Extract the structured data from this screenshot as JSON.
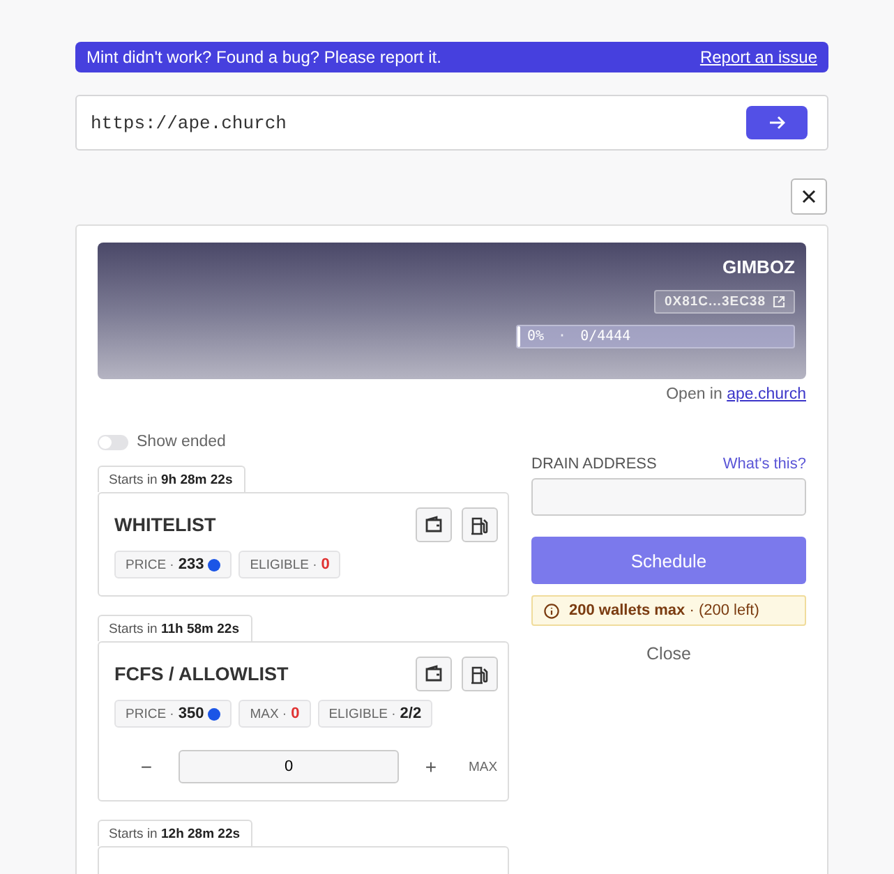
{
  "banner": {
    "message": "Mint didn't work? Found a bug? Please report it.",
    "link": "Report an issue"
  },
  "url_bar": {
    "value": "https://ape.church"
  },
  "collection": {
    "name": "GIMBOZ",
    "address": "0X81C...3EC38",
    "progress_percent": "0%",
    "progress_separator": "·",
    "progress_count": "0/4444",
    "level": 0,
    "open_in_prefix": "Open in",
    "open_in_link": "ape.church"
  },
  "show_ended": {
    "label": "Show ended",
    "on": false
  },
  "phases": [
    {
      "starts_prefix": "Starts in",
      "starts_time": "9h 28m 22s",
      "title": "WHITELIST",
      "chips": [
        {
          "kind": "price",
          "label": "PRICE ·",
          "value": "233",
          "alert": false
        },
        {
          "kind": "plain",
          "label": "ELIGIBLE ·",
          "value": "0",
          "alert": true
        }
      ]
    },
    {
      "starts_prefix": "Starts in",
      "starts_time": "11h 58m 22s",
      "title": "FCFS / ALLOWLIST",
      "chips": [
        {
          "kind": "price",
          "label": "PRICE ·",
          "value": "350",
          "alert": false
        },
        {
          "kind": "plain",
          "label": "MAX ·",
          "value": "0",
          "alert": true
        },
        {
          "kind": "plain",
          "label": "ELIGIBLE ·",
          "value": "2/2",
          "alert": false
        }
      ],
      "quantity": {
        "minus": "−",
        "value": "0",
        "plus": "+",
        "max": "MAX"
      }
    },
    {
      "starts_prefix": "Starts in",
      "starts_time": "12h 28m 22s"
    }
  ],
  "drain": {
    "label": "DRAIN ADDRESS",
    "help": "What's this?"
  },
  "schedule_button": "Schedule",
  "notice": {
    "strong": "200 wallets max",
    "rest": "· (200 left)"
  },
  "close_link": "Close"
}
